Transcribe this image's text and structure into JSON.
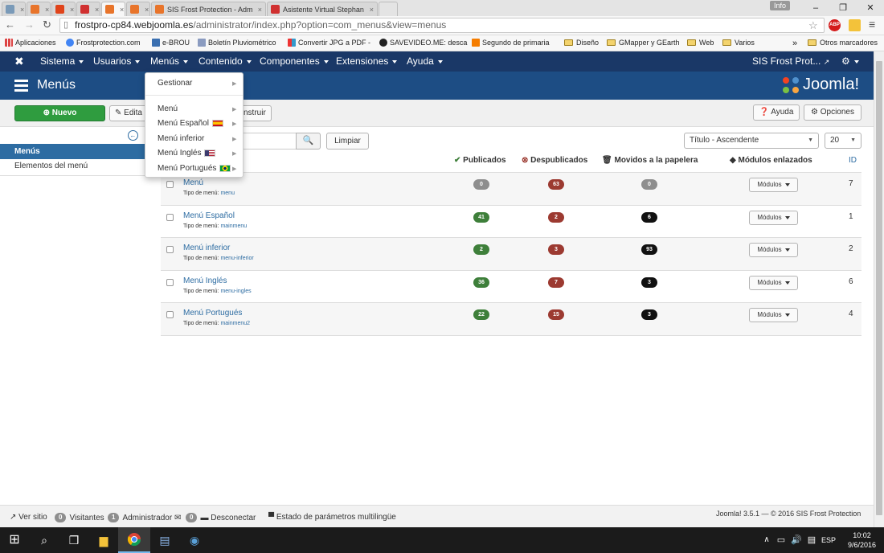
{
  "browser": {
    "tabs": [
      {
        "title": "",
        "icon_color": "#7a9ab8",
        "active": false
      },
      {
        "title": "",
        "icon_color": "#e8742a",
        "active": false
      },
      {
        "title": "",
        "icon_color": "#e0441b",
        "active": false
      },
      {
        "title": "",
        "icon_color": "#d03030",
        "active": false
      },
      {
        "title": "",
        "icon_color": "#e8742a",
        "active": true
      },
      {
        "title": "",
        "icon_color": "#e8742a",
        "active": false
      },
      {
        "title": "SIS Frost Protection - Adm",
        "icon_color": "#e8742a",
        "active": false
      },
      {
        "title": "Asistente Virtual Stephan",
        "icon_color": "#d03030",
        "active": false
      }
    ],
    "info_badge": "Info",
    "url_domain": "frostpro-cp84.webjoomla.es",
    "url_path": "/administrator/index.php?option=com_menus&view=menus",
    "bookmarks": [
      "Aplicaciones",
      "Frostprotection.com",
      "e-BROU",
      "Boletín Pluviométrico",
      "Convertir JPG a PDF -",
      "SAVEVIDEO.ME: desca",
      "Segundo de primaria",
      "Diseño",
      "GMapper y GEarth",
      "Web",
      "Varios"
    ],
    "bookmarks_more": "»",
    "other_bookmarks": "Otros marcadores"
  },
  "nav": {
    "items": [
      "Sistema",
      "Usuarios",
      "Menús",
      "Contenido",
      "Componentes",
      "Extensiones",
      "Ayuda"
    ],
    "site_name": "SIS Frost Prot..."
  },
  "header": {
    "title": "Menús",
    "logo_text": "Joomla!"
  },
  "toolbar": {
    "new_label": "Nuevo",
    "edit_label": "Edita",
    "rebuild_label": "nstruir",
    "help_label": "Ayuda",
    "options_label": "Opciones"
  },
  "sidebar": {
    "items": [
      "Menús",
      "Elementos del menú"
    ]
  },
  "filters": {
    "clear_label": "Limpiar",
    "sort_value": "Título - Ascendente",
    "limit_value": "20"
  },
  "table": {
    "headers": {
      "published": "Publicados",
      "unpublished": "Despublicados",
      "trashed": "Movidos a la papelera",
      "modules": "Módulos enlazados",
      "id": "ID"
    },
    "type_prefix": "Tipo de menú:",
    "modules_button": "Módulos",
    "rows": [
      {
        "title": "Menú",
        "type": "menu",
        "published": "0",
        "unpublished": "63",
        "trashed": "0",
        "id": "7"
      },
      {
        "title": "Menú Español",
        "type": "mainmenu",
        "published": "41",
        "unpublished": "2",
        "trashed": "6",
        "id": "1"
      },
      {
        "title": "Menú inferior",
        "type": "menu-inferior",
        "published": "2",
        "unpublished": "3",
        "trashed": "93",
        "id": "2"
      },
      {
        "title": "Menú Inglés",
        "type": "menu-ingles",
        "published": "36",
        "unpublished": "7",
        "trashed": "3",
        "id": "6"
      },
      {
        "title": "Menú Portugués",
        "type": "mainmenu2",
        "published": "22",
        "unpublished": "15",
        "trashed": "3",
        "id": "4"
      }
    ]
  },
  "dropdown": {
    "manage_label": "Gestionar",
    "items": [
      "Menú",
      "Menú Español",
      "Menú inferior",
      "Menú Inglés",
      "Menú Portugués"
    ]
  },
  "status": {
    "view_site": "Ver sitio",
    "visitors_count": "0",
    "visitors_label": "Visitantes",
    "admin_count": "1",
    "admin_label": "Administrador",
    "messages_count": "0",
    "logout_label": "Desconectar",
    "multilang_label": "Estado de parámetros multilingüe",
    "version_text": "Joomla! 3.5.1 — © 2016 SIS Frost Protection"
  },
  "taskbar": {
    "language": "ESP",
    "time": "10:02",
    "date": "9/6/2016"
  },
  "colors": {
    "nav_bg": "#1a3867",
    "header_bg": "#1d4d84",
    "published": "#3e7f3a",
    "unpublished": "#9c3a31",
    "trashed": "#111111",
    "link": "#2d6ca2"
  }
}
